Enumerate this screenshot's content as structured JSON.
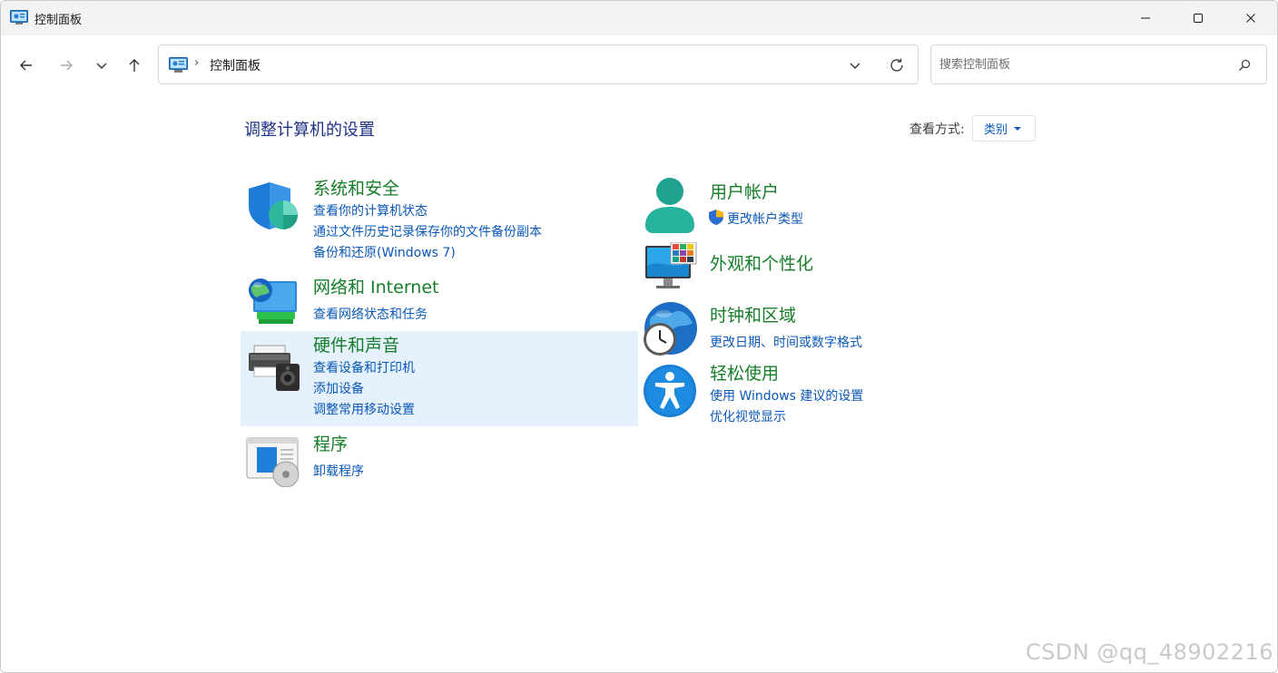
{
  "window": {
    "title": "控制面板",
    "minimize_icon": "minimize-icon",
    "maximize_icon": "maximize-icon",
    "close_icon": "close-icon"
  },
  "nav": {
    "back_icon": "arrow-left-icon",
    "forward_icon": "arrow-right-icon",
    "recent_icon": "chevron-down-icon",
    "up_icon": "arrow-up-icon",
    "address_sep": "›",
    "address_text": "控制面板",
    "search_placeholder": "搜索控制面板"
  },
  "main": {
    "heading": "调整计算机的设置",
    "view_by_label": "查看方式:",
    "view_by_value": "类别"
  },
  "categories": {
    "system": {
      "title": "系统和安全",
      "links": [
        "查看你的计算机状态",
        "通过文件历史记录保存你的文件备份副本",
        "备份和还原(Windows 7)"
      ]
    },
    "network": {
      "title": "网络和 Internet",
      "links": [
        "查看网络状态和任务"
      ]
    },
    "hardware": {
      "title": "硬件和声音",
      "links": [
        "查看设备和打印机",
        "添加设备",
        "调整常用移动设置"
      ]
    },
    "programs": {
      "title": "程序",
      "links": [
        "卸载程序"
      ]
    },
    "users": {
      "title": "用户帐户",
      "links": [
        "更改帐户类型"
      ]
    },
    "appearance": {
      "title": "外观和个性化",
      "links": []
    },
    "clock": {
      "title": "时钟和区域",
      "links": [
        "更改日期、时间或数字格式"
      ]
    },
    "ease": {
      "title": "轻松使用",
      "links": [
        "使用 Windows 建议的设置",
        "优化视觉显示"
      ]
    }
  },
  "colors": {
    "category_title": "#147e28",
    "link": "#0a58b8",
    "heading": "#1e3287",
    "hover_bg": "#e5f2fd"
  },
  "watermark": "CSDN @qq_48902216"
}
